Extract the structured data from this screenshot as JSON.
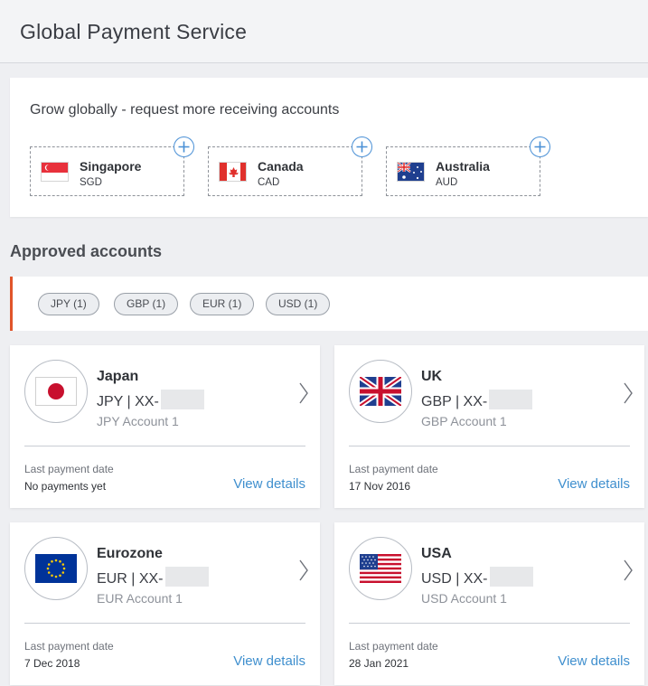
{
  "header": {
    "title": "Global Payment Service"
  },
  "grow": {
    "title": "Grow globally - request more receiving accounts",
    "items": [
      {
        "name": "Singapore",
        "code": "SGD",
        "flag": "singapore-flag-icon"
      },
      {
        "name": "Canada",
        "code": "CAD",
        "flag": "canada-flag-icon"
      },
      {
        "name": "Australia",
        "code": "AUD",
        "flag": "australia-flag-icon"
      }
    ]
  },
  "approved": {
    "title": "Approved accounts",
    "filters": [
      "JPY (1)",
      "GBP (1)",
      "EUR (1)",
      "USD (1)"
    ],
    "accent_color": "#e0542a"
  },
  "accounts": [
    {
      "country": "Japan",
      "number": "JPY | XX-",
      "name": "JPY Account 1",
      "last_payment_label": "Last payment date",
      "last_payment": "No payments yet",
      "link": "View details",
      "flag": "japan-flag-icon"
    },
    {
      "country": "UK",
      "number": "GBP | XX-",
      "name": "GBP Account 1",
      "last_payment_label": "Last payment date",
      "last_payment": "17 Nov 2016",
      "link": "View details",
      "flag": "uk-flag-icon"
    },
    {
      "country": "Eurozone",
      "number": "EUR | XX-",
      "name": "EUR Account 1",
      "last_payment_label": "Last payment date",
      "last_payment": "7 Dec 2018",
      "link": "View details",
      "flag": "eu-flag-icon"
    },
    {
      "country": "USA",
      "number": "USD | XX-",
      "name": "USD Account 1",
      "last_payment_label": "Last payment date",
      "last_payment": "28 Jan 2021",
      "link": "View details",
      "flag": "usa-flag-icon"
    }
  ],
  "colors": {
    "link": "#3f8fce",
    "plus_button": "#4a90d6"
  }
}
